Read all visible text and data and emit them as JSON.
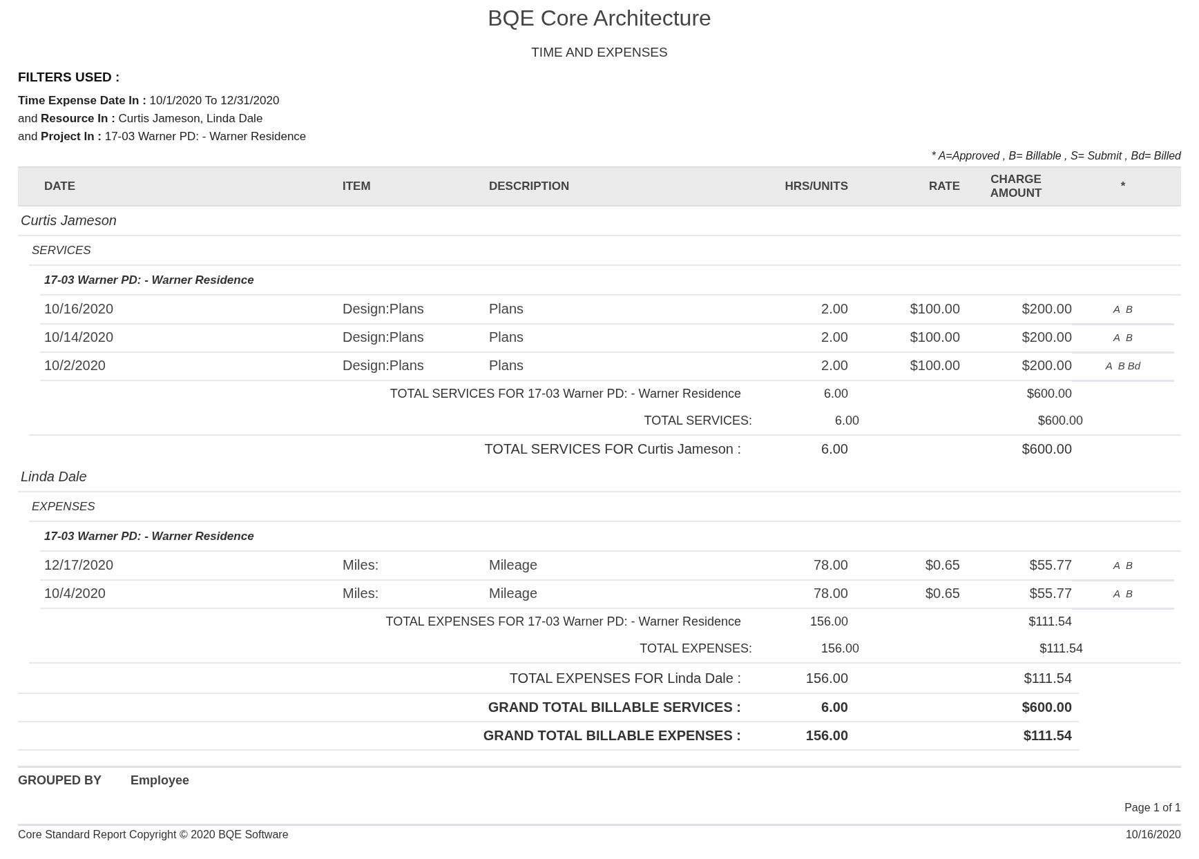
{
  "title": "BQE Core Architecture",
  "subtitle": "TIME AND EXPENSES",
  "filters": {
    "heading": "FILTERS USED :",
    "lines": [
      "**Time Expense Date In :** 10/1/2020 To 12/31/2020",
      "and **Resource In :**  Curtis Jameson, Linda Dale",
      "and **Project In :**  17-03 Warner PD: - Warner Residence"
    ]
  },
  "legend": "* A=Approved , B= Billable , S= Submit , Bd= Billed",
  "columns": [
    "DATE",
    "ITEM",
    "DESCRIPTION",
    "HRS/UNITS",
    "RATE",
    "CHARGE AMOUNT",
    "*"
  ],
  "groups": [
    {
      "resource": "Curtis Jameson",
      "sections": [
        {
          "category": "SERVICES",
          "projects": [
            {
              "name": "17-03 Warner PD: - Warner Residence",
              "entries": [
                {
                  "date": "10/16/2020",
                  "item": "Design:Plans",
                  "description": "Plans",
                  "hours": "2.00",
                  "rate": "$100.00",
                  "amount": "$200.00",
                  "flags": "A  B"
                },
                {
                  "date": "10/14/2020",
                  "item": "Design:Plans",
                  "description": "Plans",
                  "hours": "2.00",
                  "rate": "$100.00",
                  "amount": "$200.00",
                  "flags": "A  B"
                },
                {
                  "date": "10/2/2020",
                  "item": "Design:Plans",
                  "description": "Plans",
                  "hours": "2.00",
                  "rate": "$100.00",
                  "amount": "$200.00",
                  "flags": "A  B Bd"
                }
              ],
              "total": {
                "label": "TOTAL SERVICES FOR 17-03 Warner PD: - Warner Residence",
                "hours": "6.00",
                "amount": "$600.00"
              }
            }
          ],
          "total": {
            "label": "TOTAL SERVICES:",
            "hours": "6.00",
            "amount": "$600.00"
          }
        }
      ],
      "total": {
        "label": "TOTAL SERVICES FOR Curtis Jameson :",
        "hours": "6.00",
        "amount": "$600.00"
      }
    },
    {
      "resource": "Linda Dale",
      "sections": [
        {
          "category": "EXPENSES",
          "projects": [
            {
              "name": "17-03 Warner PD: - Warner Residence",
              "entries": [
                {
                  "date": "12/17/2020",
                  "item": "Miles:",
                  "description": "Mileage",
                  "hours": "78.00",
                  "rate": "$0.65",
                  "amount": "$55.77",
                  "flags": "A  B"
                },
                {
                  "date": "10/4/2020",
                  "item": "Miles:",
                  "description": "Mileage",
                  "hours": "78.00",
                  "rate": "$0.65",
                  "amount": "$55.77",
                  "flags": "A  B"
                }
              ],
              "total": {
                "label": "TOTAL EXPENSES FOR 17-03 Warner PD: - Warner Residence",
                "hours": "156.00",
                "amount": "$111.54"
              }
            }
          ],
          "total": {
            "label": "TOTAL EXPENSES:",
            "hours": "156.00",
            "amount": "$111.54"
          }
        }
      ],
      "total": {
        "label": "TOTAL EXPENSES FOR Linda Dale :",
        "hours": "156.00",
        "amount": "$111.54"
      }
    }
  ],
  "grand_totals": [
    {
      "label": "GRAND TOTAL BILLABLE SERVICES :",
      "hours": "6.00",
      "amount": "$600.00"
    },
    {
      "label": "GRAND TOTAL BILLABLE EXPENSES :",
      "hours": "156.00",
      "amount": "$111.54"
    }
  ],
  "grouped_by": {
    "label": "GROUPED BY",
    "value": "Employee"
  },
  "page": "Page 1 of 1",
  "copyright": "Core Standard Report Copyright © 2020 BQE Software",
  "printed_date": "10/16/2020"
}
